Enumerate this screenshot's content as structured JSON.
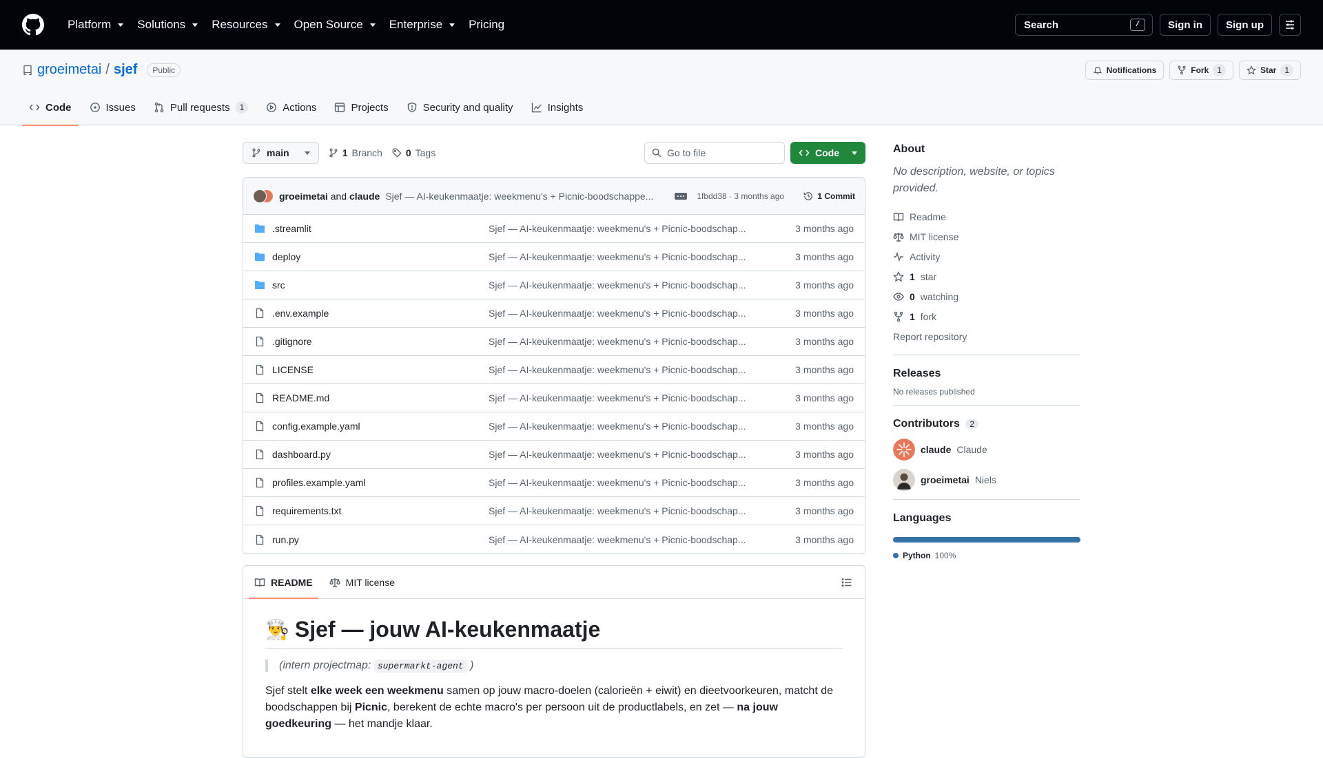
{
  "header": {
    "nav": [
      "Platform",
      "Solutions",
      "Resources",
      "Open Source",
      "Enterprise",
      "Pricing"
    ],
    "search_label": "Search",
    "search_key": "/",
    "sign_in": "Sign in",
    "sign_up": "Sign up"
  },
  "repo": {
    "owner": "groeimetai",
    "separator": "/",
    "name": "sjef",
    "visibility": "Public",
    "notifications": "Notifications",
    "fork_label": "Fork",
    "fork_count": "1",
    "star_label": "Star",
    "star_count": "1"
  },
  "tabs": [
    {
      "label": "Code",
      "icon": "code-icon",
      "active": true
    },
    {
      "label": "Issues",
      "icon": "issue-icon"
    },
    {
      "label": "Pull requests",
      "icon": "pull-request-icon",
      "count": "1"
    },
    {
      "label": "Actions",
      "icon": "play-icon"
    },
    {
      "label": "Projects",
      "icon": "table-icon"
    },
    {
      "label": "Security and quality",
      "icon": "shield-icon"
    },
    {
      "label": "Insights",
      "icon": "graph-icon"
    }
  ],
  "toolbar": {
    "branch": "main",
    "branches_count": "1",
    "branches_label": "Branch",
    "tags_count": "0",
    "tags_label": "Tags",
    "goto_placeholder": "Go to file",
    "code_button": "Code"
  },
  "latest_commit": {
    "author1": "groeimetai",
    "and": "and",
    "author2": "claude",
    "message": "Sjef — AI-keukenmaatje: weekmenu's + Picnic-boodschappe...",
    "meta": "1fbdd38 · 3 months ago",
    "commit_count": "1 Commit"
  },
  "files": [
    {
      "name": ".streamlit",
      "type": "dir",
      "message": "Sjef — AI-keukenmaatje: weekmenu's + Picnic-boodschap...",
      "age": "3 months ago"
    },
    {
      "name": "deploy",
      "type": "dir",
      "message": "Sjef — AI-keukenmaatje: weekmenu's + Picnic-boodschap...",
      "age": "3 months ago"
    },
    {
      "name": "src",
      "type": "dir",
      "message": "Sjef — AI-keukenmaatje: weekmenu's + Picnic-boodschap...",
      "age": "3 months ago"
    },
    {
      "name": ".env.example",
      "type": "file",
      "message": "Sjef — AI-keukenmaatje: weekmenu's + Picnic-boodschap...",
      "age": "3 months ago"
    },
    {
      "name": ".gitignore",
      "type": "file",
      "message": "Sjef — AI-keukenmaatje: weekmenu's + Picnic-boodschap...",
      "age": "3 months ago"
    },
    {
      "name": "LICENSE",
      "type": "file",
      "message": "Sjef — AI-keukenmaatje: weekmenu's + Picnic-boodschap...",
      "age": "3 months ago"
    },
    {
      "name": "README.md",
      "type": "file",
      "message": "Sjef — AI-keukenmaatje: weekmenu's + Picnic-boodschap...",
      "age": "3 months ago"
    },
    {
      "name": "config.example.yaml",
      "type": "file",
      "message": "Sjef — AI-keukenmaatje: weekmenu's + Picnic-boodschap...",
      "age": "3 months ago"
    },
    {
      "name": "dashboard.py",
      "type": "file",
      "message": "Sjef — AI-keukenmaatje: weekmenu's + Picnic-boodschap...",
      "age": "3 months ago"
    },
    {
      "name": "profiles.example.yaml",
      "type": "file",
      "message": "Sjef — AI-keukenmaatje: weekmenu's + Picnic-boodschap...",
      "age": "3 months ago"
    },
    {
      "name": "requirements.txt",
      "type": "file",
      "message": "Sjef — AI-keukenmaatje: weekmenu's + Picnic-boodschap...",
      "age": "3 months ago"
    },
    {
      "name": "run.py",
      "type": "file",
      "message": "Sjef — AI-keukenmaatje: weekmenu's + Picnic-boodschap...",
      "age": "3 months ago"
    }
  ],
  "readme": {
    "tab_readme": "README",
    "tab_license": "MIT license",
    "emoji": "👨‍🍳",
    "title": "Sjef — jouw AI-keukenmaatje",
    "quote_prefix": "(intern projectmap: ",
    "quote_code": "supermarkt-agent",
    "quote_suffix": " )",
    "p1": "Sjef stelt ",
    "p1_b1": "elke week een weekmenu",
    "p2": " samen op jouw macro-doelen (calorieën + eiwit) en dieetvoorkeuren, matcht de boodschappen bij ",
    "p2_b2": "Picnic",
    "p3": ", berekent de echte macro's per persoon uit de productlabels, en zet — ",
    "p3_b3": "na jouw goedkeuring",
    "p4": " — het mandje klaar."
  },
  "about": {
    "title": "About",
    "description": "No description, website, or topics provided.",
    "readme": "Readme",
    "license": "MIT license",
    "activity": "Activity",
    "stars_count": "1",
    "stars_label": "star",
    "watching_count": "0",
    "watching_label": "watching",
    "forks_count": "1",
    "forks_label": "fork",
    "report": "Report repository"
  },
  "releases": {
    "title": "Releases",
    "text": "No releases published"
  },
  "contributors": {
    "title": "Contributors",
    "count": "2",
    "list": [
      {
        "login": "claude",
        "name": "Claude"
      },
      {
        "login": "groeimetai",
        "name": "Niels"
      }
    ]
  },
  "languages": {
    "title": "Languages",
    "items": [
      {
        "name": "Python",
        "percent": "100%",
        "fraction": 1.0,
        "color": "#3572a5"
      }
    ]
  },
  "colors": {
    "header_bg": "#010409",
    "link": "#0969da",
    "primary_button": "#1f883d",
    "tab_underline": "#fd8c73",
    "folder": "#54aeff"
  }
}
